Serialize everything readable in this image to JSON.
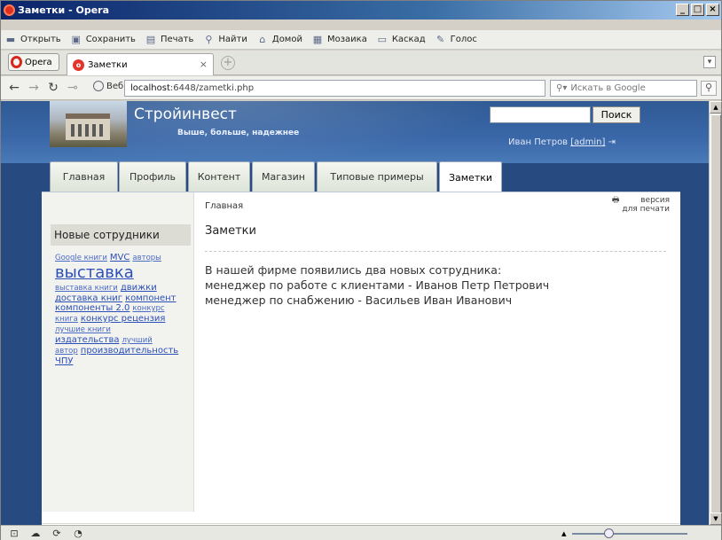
{
  "window": {
    "title": "Заметки - Opera",
    "min": "_",
    "max": "□",
    "close": "×"
  },
  "toolbar": {
    "items": [
      {
        "label": "Открыть",
        "icon": "folder-icon"
      },
      {
        "label": "Сохранить",
        "icon": "save-icon"
      },
      {
        "label": "Печать",
        "icon": "print-icon"
      },
      {
        "label": "Найти",
        "icon": "search-icon"
      },
      {
        "label": "Домой",
        "icon": "home-icon"
      },
      {
        "label": "Мозаика",
        "icon": "tile-icon"
      },
      {
        "label": "Каскад",
        "icon": "cascade-icon"
      },
      {
        "label": "Голос",
        "icon": "voice-icon"
      }
    ]
  },
  "tabs": {
    "opera_label": "Opera",
    "active_tab_label": "Заметки",
    "close": "×",
    "new_tab": "+"
  },
  "address": {
    "web_label": "Веб",
    "host": "localhost",
    "path": ":6448/zametki.php",
    "search_placeholder": "Искать в Google"
  },
  "site": {
    "name": "Стройинвест",
    "slogan": "Выше, больше, надежнее",
    "search_button": "Поиск",
    "user_name": "Иван Петров",
    "user_role": "[admin]"
  },
  "nav": {
    "items": [
      {
        "label": "Главная",
        "active": false
      },
      {
        "label": "Профиль",
        "active": false
      },
      {
        "label": "Контент",
        "active": false
      },
      {
        "label": "Магазин",
        "active": false
      },
      {
        "label": "Типовые примеры",
        "active": false
      },
      {
        "label": "Заметки",
        "active": true
      }
    ]
  },
  "sidebar": {
    "block_title": "Новые сотрудники",
    "tags": [
      {
        "text": "Google книги",
        "size": "s"
      },
      {
        "text": "MVC",
        "size": "m"
      },
      {
        "text": "авторы",
        "size": "s"
      },
      {
        "text": "выставка",
        "size": "big"
      },
      {
        "text": "выставка книги",
        "size": "s"
      },
      {
        "text": "движки",
        "size": "m"
      },
      {
        "text": "доставка книг",
        "size": "m"
      },
      {
        "text": "компонент",
        "size": "m"
      },
      {
        "text": "компоненты 2.0",
        "size": "m"
      },
      {
        "text": "конкурс",
        "size": "s"
      },
      {
        "text": "книга",
        "size": "s"
      },
      {
        "text": "конкурс рецензия",
        "size": "m"
      },
      {
        "text": "лучшие книги",
        "size": "s"
      },
      {
        "text": "издательства",
        "size": "m"
      },
      {
        "text": "лучший",
        "size": "s"
      },
      {
        "text": "автор",
        "size": "s"
      },
      {
        "text": "производительность",
        "size": "m"
      },
      {
        "text": "ЧПУ",
        "size": "m"
      }
    ]
  },
  "main": {
    "breadcrumb": "Главная",
    "print_line1": "версия",
    "print_line2": "для печати",
    "title": "Заметки",
    "body": "В нашей фирме появились два новых сотрудника:\nменеджер по работе с клиентами - Иванов Петр Петрович\nменеджер по снабжению - Васильев Иван Иванович"
  }
}
